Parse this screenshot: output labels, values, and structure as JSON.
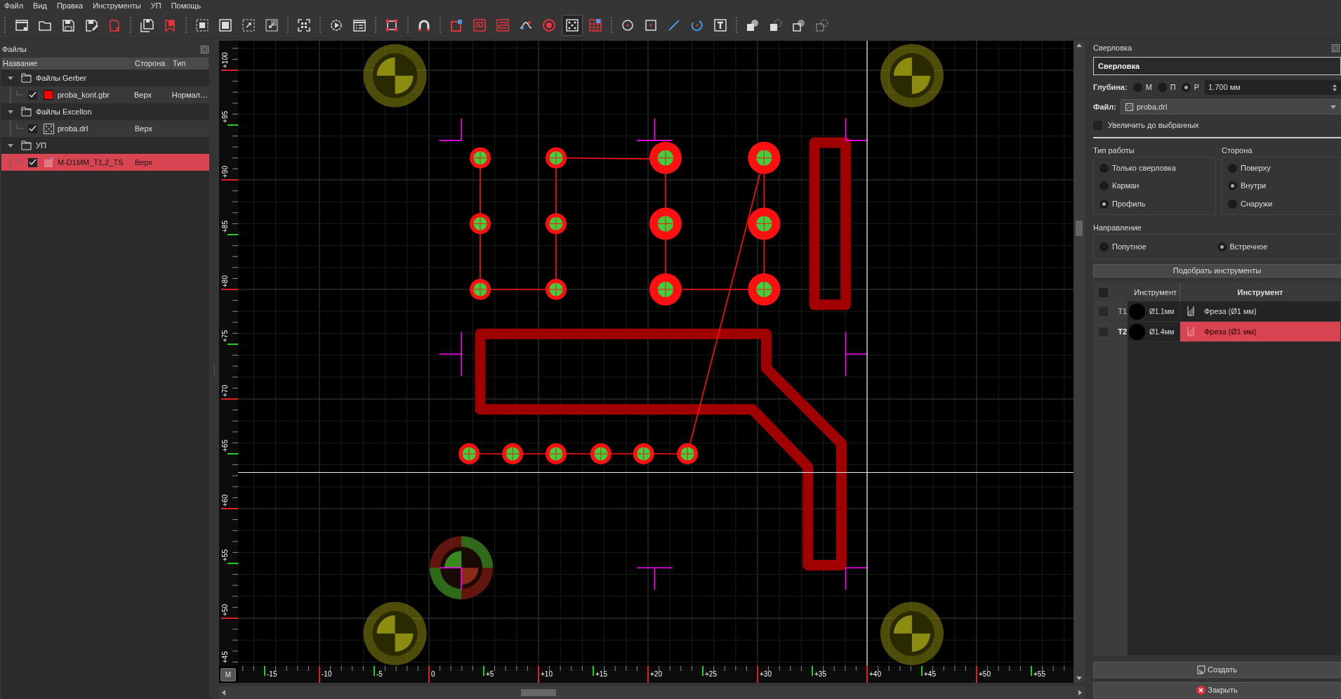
{
  "menu": [
    "Файл",
    "Вид",
    "Правка",
    "Инструменты",
    "УП",
    "Помощь"
  ],
  "toolbar": [
    {
      "selected": false
    },
    {
      "selected": false
    },
    {
      "selected": false
    },
    {
      "selected": false
    },
    {
      "selected": false
    },
    {
      "selected": false
    },
    {
      "selected": false
    },
    {
      "selected": false
    },
    {
      "selected": false
    },
    {
      "selected": false
    },
    {
      "selected": false
    },
    {
      "selected": false
    },
    {
      "selected": false
    },
    {
      "selected": false
    },
    {
      "selected": false
    },
    {
      "selected": false
    },
    {
      "selected": false
    },
    {
      "selected": false
    },
    {
      "selected": false
    },
    {
      "selected": false
    },
    {
      "selected": false
    },
    {
      "selected": true
    },
    {
      "selected": false
    },
    {
      "selected": false
    },
    {
      "selected": false
    },
    {
      "selected": false
    },
    {
      "selected": false
    },
    {
      "selected": false
    },
    {
      "selected": false
    },
    {
      "selected": false
    },
    {
      "selected": false
    },
    {
      "selected": false
    }
  ],
  "files_panel": {
    "title": "Файлы",
    "columns": [
      "Название",
      "Сторона",
      "Тип"
    ],
    "groups": [
      {
        "label": "Файлы Gerber",
        "expanded": true,
        "children": [
          {
            "kind": "gerber",
            "name": "proba_kont.gbr",
            "side": "Верх",
            "type": "Нормал…",
            "checked": true,
            "selected": false,
            "color": "#ff0000"
          }
        ]
      },
      {
        "label": "Файлы Excellon",
        "expanded": true,
        "children": [
          {
            "kind": "excellon",
            "name": "proba.drl",
            "side": "Верх",
            "checked": true,
            "selected": false
          }
        ]
      },
      {
        "label": "УП",
        "expanded": true,
        "children": [
          {
            "kind": "gcode",
            "name": "M-D1MM_T1,2_TS",
            "side": "Верх",
            "checked": true,
            "selected": true
          }
        ]
      }
    ]
  },
  "canvas": {
    "unit_button": "M",
    "x_ruler_labels": [
      "-15",
      "-10",
      "-5",
      "0",
      "+5",
      "+10",
      "+15",
      "+20",
      "+25",
      "+30",
      "+35",
      "+40",
      "+45",
      "+50",
      "+55"
    ],
    "y_ruler_labels": [
      "+100",
      "+95",
      "+90",
      "+85",
      "+80",
      "+75",
      "+70",
      "+65",
      "+60",
      "+55",
      "+50",
      "+45"
    ]
  },
  "drill_panel": {
    "title": "Сверловка",
    "name": "Сверловка",
    "depth": {
      "label": "Глубина:",
      "options": [
        {
          "label": "М",
          "selected": false
        },
        {
          "label": "П",
          "selected": false
        },
        {
          "label": "Р",
          "selected": true
        }
      ],
      "value": "1.700 мм"
    },
    "file": {
      "label": "Файл:",
      "value": "proba.drl"
    },
    "expand_checkbox": {
      "label": "Увеличить до выбранных",
      "checked": false
    },
    "work_type": {
      "title": "Тип работы",
      "options": [
        {
          "label": "Только сверловка",
          "selected": false
        },
        {
          "label": "Карман",
          "selected": false
        },
        {
          "label": "Профиль",
          "selected": true
        }
      ]
    },
    "side": {
      "title": "Сторона",
      "options": [
        {
          "label": "Поверху",
          "selected": false
        },
        {
          "label": "Внутри",
          "selected": true
        },
        {
          "label": "Снаружи",
          "selected": false
        }
      ]
    },
    "direction": {
      "title": "Направление",
      "options": [
        {
          "label": "Попутное",
          "selected": false
        },
        {
          "label": "Встречное",
          "selected": true
        }
      ]
    },
    "pick_button": "Подобрать инструменты",
    "table": {
      "header_checked": false,
      "columns": [
        "Инструмент",
        "Инструмент"
      ],
      "rows": [
        {
          "id": "T1",
          "diameter": "Ø1.1мм",
          "tool": "Фреза (Ø1 мм)",
          "checked": false,
          "selected": false
        },
        {
          "id": "T2",
          "diameter": "Ø1.4мм",
          "tool": "Фреза (Ø1 мм)",
          "checked": false,
          "selected": true
        }
      ]
    },
    "buttons": [
      {
        "kind": "create",
        "label": "Создать"
      },
      {
        "kind": "close",
        "label": "Закрыть"
      }
    ]
  }
}
